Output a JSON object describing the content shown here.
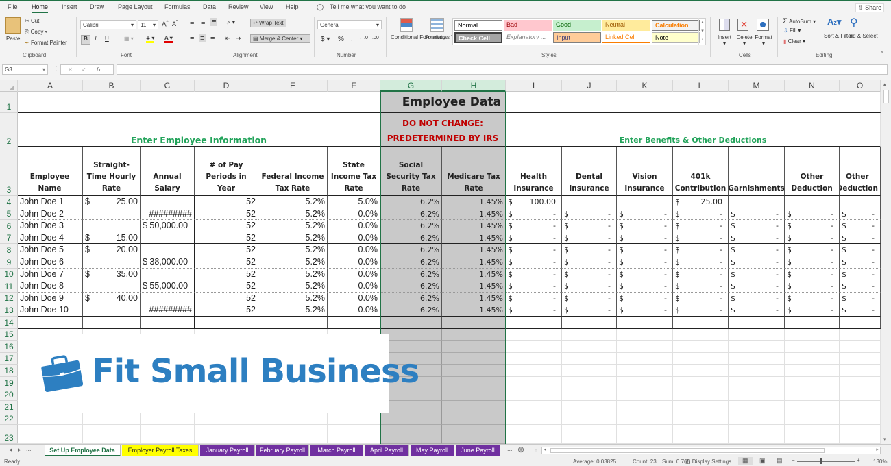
{
  "menu": [
    "File",
    "Home",
    "Insert",
    "Draw",
    "Page Layout",
    "Formulas",
    "Data",
    "Review",
    "View",
    "Help"
  ],
  "active_menu": "Home",
  "tell_me": "Tell me what you want to do",
  "share": "Share",
  "ribbon": {
    "clipboard": {
      "paste": "Paste",
      "cut": "Cut",
      "copy": "Copy",
      "format_painter": "Format Painter",
      "label": "Clipboard"
    },
    "font": {
      "name": "Calibri",
      "size": "11",
      "bold": "B",
      "italic": "I",
      "underline": "U",
      "label": "Font"
    },
    "alignment": {
      "wrap_text": "Wrap Text",
      "merge_center": "Merge & Center",
      "label": "Alignment"
    },
    "number": {
      "format": "General",
      "currency": "$",
      "percent": "%",
      "comma": ",",
      "label": "Number"
    },
    "styles": {
      "conditional_formatting": "Conditional Formatting",
      "format_as_table": "Format as Table",
      "label": "Styles",
      "gallery": [
        {
          "name": "Normal",
          "bg": "#ffffff",
          "fg": "#000000"
        },
        {
          "name": "Bad",
          "bg": "#ffc7ce",
          "fg": "#9c0006"
        },
        {
          "name": "Good",
          "bg": "#c6efce",
          "fg": "#006100"
        },
        {
          "name": "Neutral",
          "bg": "#ffeb9c",
          "fg": "#9c5700"
        },
        {
          "name": "Calculation",
          "bg": "#f2f2f2",
          "fg": "#fa7d00"
        },
        {
          "name": "Check Cell",
          "bg": "#a5a5a5",
          "fg": "#ffffff"
        },
        {
          "name": "Explanatory ...",
          "bg": "#ffffff",
          "fg": "#7f7f7f"
        },
        {
          "name": "Input",
          "bg": "#ffcc99",
          "fg": "#3f3f76"
        },
        {
          "name": "Linked Cell",
          "bg": "#ffffff",
          "fg": "#fa7d00"
        },
        {
          "name": "Note",
          "bg": "#ffffcc",
          "fg": "#000000"
        }
      ]
    },
    "cells": {
      "insert": "Insert",
      "delete": "Delete",
      "format": "Format",
      "label": "Cells"
    },
    "editing": {
      "autosum": "AutoSum",
      "fill": "Fill",
      "clear": "Clear",
      "sort_filter": "Sort & Filter",
      "find_select": "Find & Select",
      "label": "Editing"
    }
  },
  "formula_bar": {
    "name_box": "G3",
    "fx": "fx",
    "value": ""
  },
  "columns": [
    "A",
    "B",
    "C",
    "D",
    "E",
    "F",
    "G",
    "H",
    "I",
    "J",
    "K",
    "L",
    "M",
    "N",
    "O"
  ],
  "selected_columns": [
    "G",
    "H"
  ],
  "rows": [
    "1",
    "2",
    "3",
    "4",
    "5",
    "6",
    "7",
    "8",
    "9",
    "10",
    "11",
    "12",
    "13",
    "14",
    "15",
    "16",
    "17",
    "18",
    "19",
    "20",
    "21",
    "22",
    "23"
  ],
  "sheet": {
    "title": "Employee Data",
    "warning_line1": "DO NOT CHANGE:",
    "warning_line2": "PREDETERMINED BY IRS",
    "section_left": "Enter Employee Information",
    "section_right": "Enter Benefits & Other Deductions",
    "headers": [
      "Employee  Name",
      "Straight-Time Hourly Rate",
      "Annual Salary",
      "# of Pay Periods in Year",
      "Federal Income Tax Rate",
      "State Income Tax Rate",
      "Social Security Tax Rate",
      "Medicare Tax Rate",
      "Health Insurance",
      "Dental Insurance",
      "Vision Insurance",
      "401k Contribution",
      "Garnishments",
      "Other Deduction",
      "Other Deduction"
    ],
    "employees": [
      {
        "name": "John Doe 1",
        "hourly": "25.00",
        "salary": "",
        "periods": "52",
        "fed": "5.2%",
        "state": "5.0%",
        "ss": "6.2%",
        "medicare": "1.45%",
        "health": "100.00",
        "dental": "",
        "vision": "",
        "k401": "25.00",
        "garn": "",
        "other1": "",
        "other2": "",
        "blank_deductions": false
      },
      {
        "name": "John Doe 2",
        "hourly": "",
        "salary": "#########",
        "periods": "52",
        "fed": "5.2%",
        "state": "0.0%",
        "ss": "6.2%",
        "medicare": "1.45%",
        "blank_deductions": true
      },
      {
        "name": "John Doe 3",
        "hourly": "",
        "salary": "$ 50,000.00",
        "periods": "52",
        "fed": "5.2%",
        "state": "0.0%",
        "ss": "6.2%",
        "medicare": "1.45%",
        "blank_deductions": true
      },
      {
        "name": "John Doe 4",
        "hourly": "15.00",
        "salary": "",
        "periods": "52",
        "fed": "5.2%",
        "state": "0.0%",
        "ss": "6.2%",
        "medicare": "1.45%",
        "blank_deductions": true
      },
      {
        "name": "John Doe 5",
        "hourly": "20.00",
        "salary": "",
        "periods": "52",
        "fed": "5.2%",
        "state": "0.0%",
        "ss": "6.2%",
        "medicare": "1.45%",
        "blank_deductions": true
      },
      {
        "name": "John Doe 6",
        "hourly": "",
        "salary": "$ 38,000.00",
        "periods": "52",
        "fed": "5.2%",
        "state": "0.0%",
        "ss": "6.2%",
        "medicare": "1.45%",
        "blank_deductions": true
      },
      {
        "name": "John Doe 7",
        "hourly": "35.00",
        "salary": "",
        "periods": "52",
        "fed": "5.2%",
        "state": "0.0%",
        "ss": "6.2%",
        "medicare": "1.45%",
        "blank_deductions": true
      },
      {
        "name": "John Doe 8",
        "hourly": "",
        "salary": "$ 55,000.00",
        "periods": "52",
        "fed": "5.2%",
        "state": "0.0%",
        "ss": "6.2%",
        "medicare": "1.45%",
        "blank_deductions": true
      },
      {
        "name": "John Doe 9",
        "hourly": "40.00",
        "salary": "",
        "periods": "52",
        "fed": "5.2%",
        "state": "0.0%",
        "ss": "6.2%",
        "medicare": "1.45%",
        "blank_deductions": true
      },
      {
        "name": "John Doe 10",
        "hourly": "",
        "salary": "#########",
        "periods": "52",
        "fed": "5.2%",
        "state": "0.0%",
        "ss": "6.2%",
        "medicare": "1.45%",
        "blank_deductions": true
      }
    ],
    "currency_symbol": "$",
    "dash": "-"
  },
  "logo": {
    "text": "Fit Small Business",
    "color": "#2d7fc1"
  },
  "sheet_tabs": [
    {
      "label": "Set Up Employee Data",
      "active": true,
      "bg": "#ffffff",
      "fg": "#217346"
    },
    {
      "label": "Employer Payroll Taxes",
      "active": false,
      "bg": "#ffff00",
      "fg": "#222222"
    },
    {
      "label": "January Payroll",
      "active": false,
      "bg": "#7030a0",
      "fg": "#ffffff"
    },
    {
      "label": "February Payroll",
      "active": false,
      "bg": "#7030a0",
      "fg": "#ffffff"
    },
    {
      "label": "March Payroll",
      "active": false,
      "bg": "#7030a0",
      "fg": "#ffffff"
    },
    {
      "label": "April Payroll",
      "active": false,
      "bg": "#7030a0",
      "fg": "#ffffff"
    },
    {
      "label": "May Payroll",
      "active": false,
      "bg": "#7030a0",
      "fg": "#ffffff"
    },
    {
      "label": "June Payroll",
      "active": false,
      "bg": "#7030a0",
      "fg": "#ffffff"
    }
  ],
  "tab_ellipsis": "...",
  "status": {
    "ready": "Ready",
    "average": "Average: 0.03825",
    "count": "Count: 23",
    "sum": "Sum: 0.765",
    "display_settings": "Display Settings",
    "zoom": "130%",
    "zoom_minus": "−",
    "zoom_plus": "+"
  },
  "colors": {
    "accent": "#217346",
    "section_green": "#22a35a",
    "warning_red": "#c00000",
    "gray_fill": "#c9c9c9"
  }
}
